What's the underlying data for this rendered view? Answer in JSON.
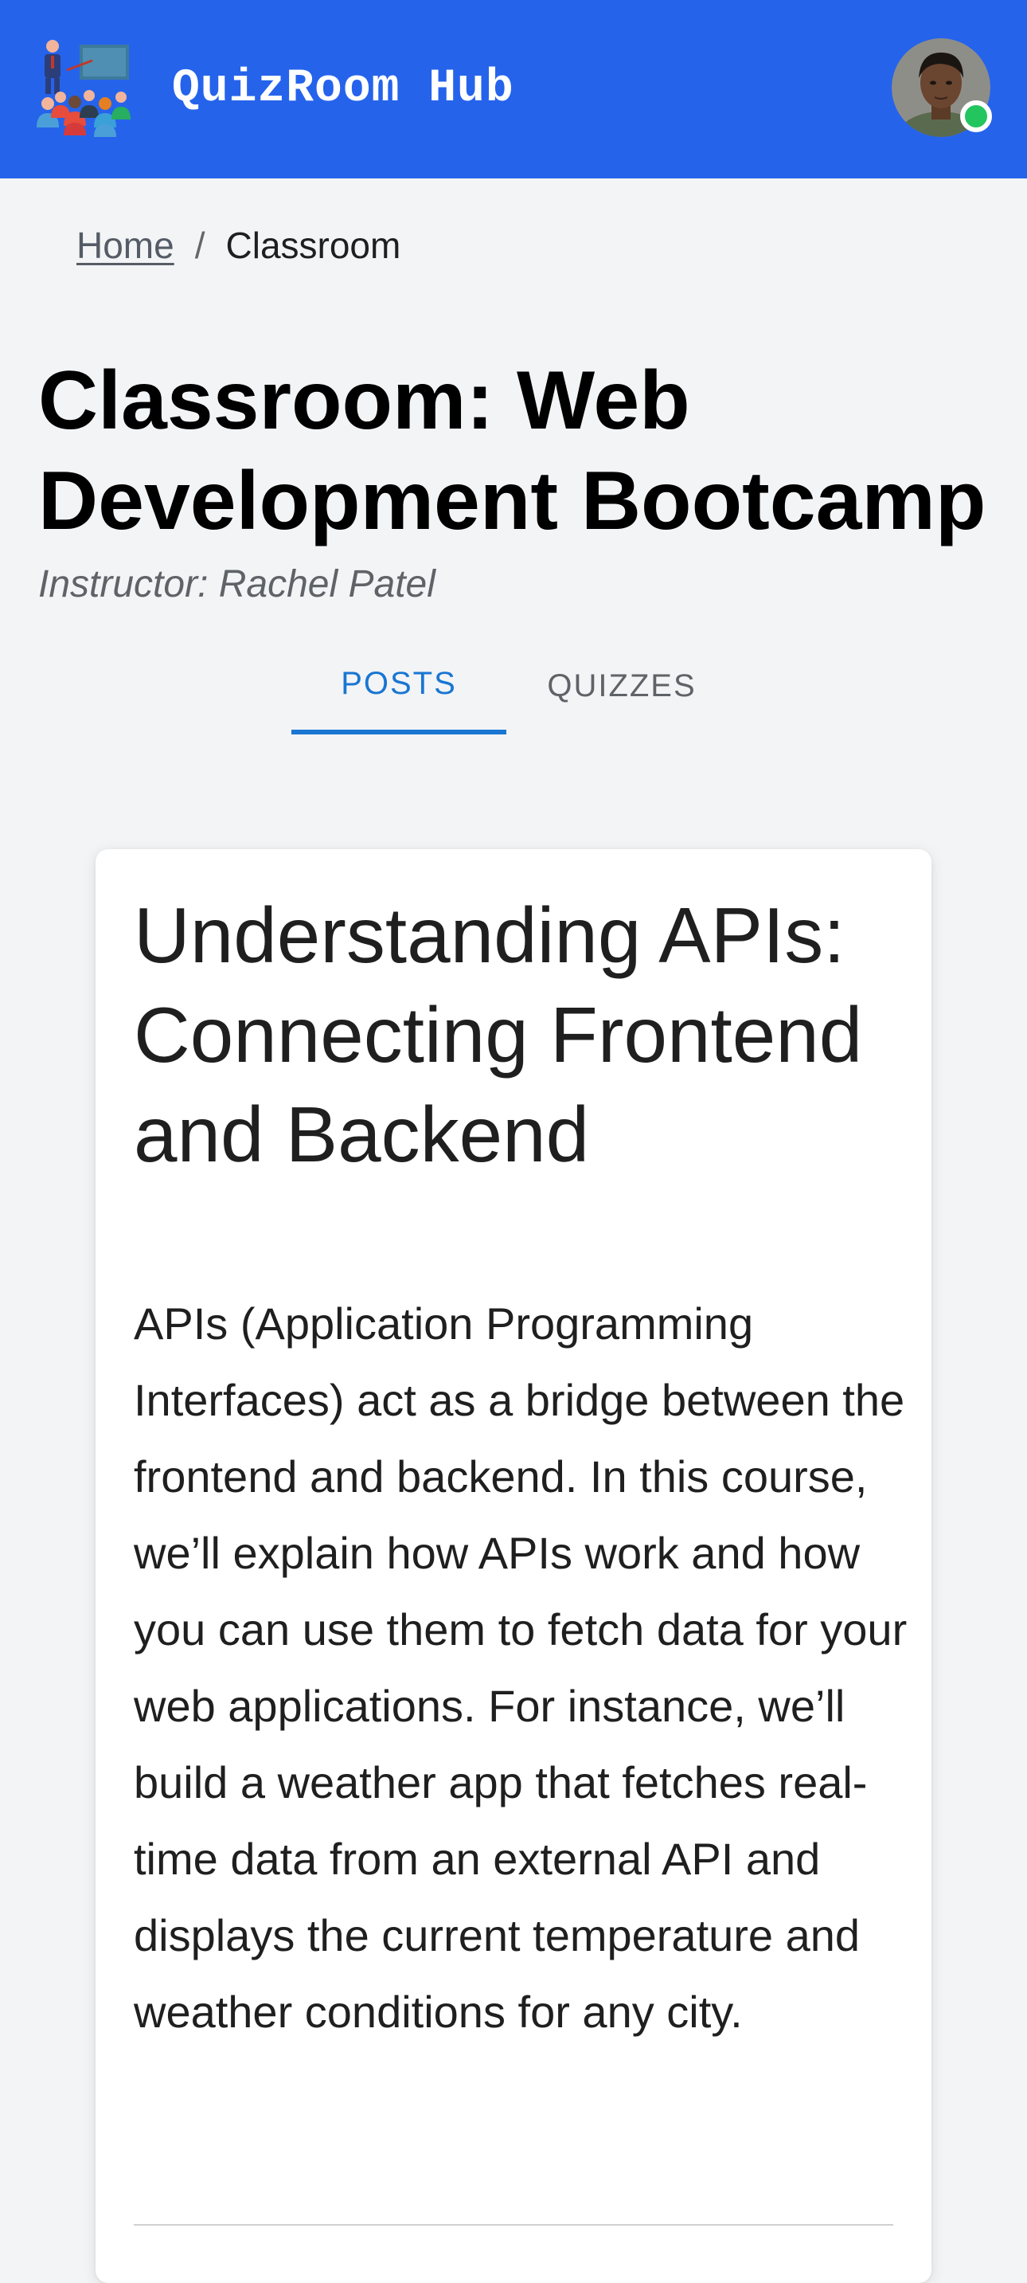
{
  "app_bar": {
    "title": "QuizRoom Hub",
    "logo_icon": "classroom-teacher-icon",
    "avatar_icon": "user-avatar",
    "status_color": "#22c55e",
    "background_color": "#2563eb"
  },
  "breadcrumb": {
    "home": "Home",
    "separator": "/",
    "current": "Classroom"
  },
  "page": {
    "title": "Classroom: Web Development Bootcamp",
    "instructor": "Instructor: Rachel Patel"
  },
  "tabs": [
    {
      "label": "POSTS",
      "active": true
    },
    {
      "label": "QUIZZES",
      "active": false
    }
  ],
  "post": {
    "title": "Understanding APIs: Connecting Frontend and Backend",
    "body": "APIs (Application Programming Interfaces) act as a bridge between the frontend and backend. In this course, we’ll explain how APIs work and how you can use them to fetch data for your web applications. For instance, we’ll build a weather app that fetches real-time data from an external API and displays the current temperature and weather conditions for any city."
  }
}
